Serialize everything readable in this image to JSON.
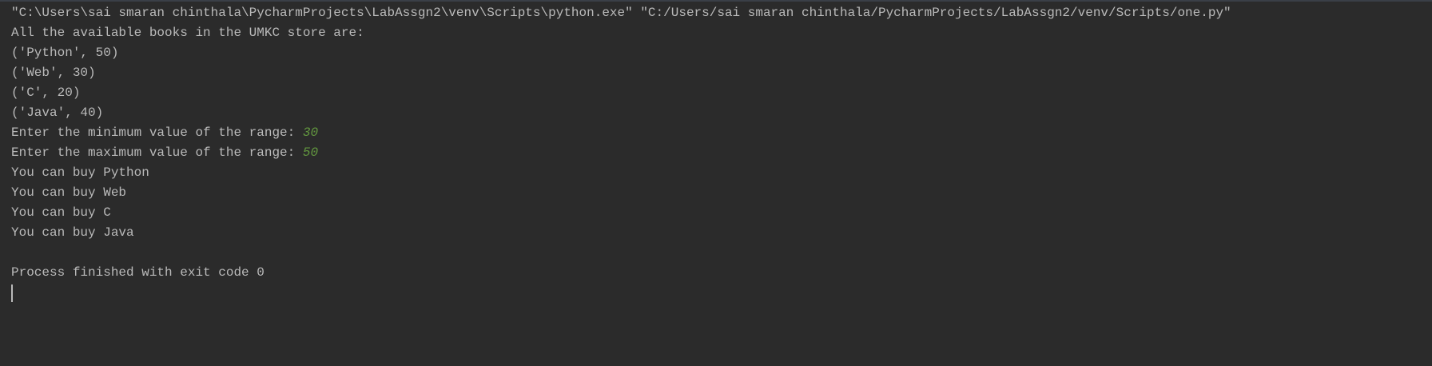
{
  "console": {
    "command": "\"C:\\Users\\sai smaran chinthala\\PycharmProjects\\LabAssgn2\\venv\\Scripts\\python.exe\" \"C:/Users/sai smaran chinthala/PycharmProjects/LabAssgn2/venv/Scripts/one.py\"",
    "header": "All the available books in the UMKC store are:",
    "books": [
      "('Python', 50)",
      "('Web', 30)",
      "('C', 20)",
      "('Java', 40)"
    ],
    "min_prompt": "Enter the minimum value of the range: ",
    "min_value": "30",
    "max_prompt": "Enter the maximum value of the range: ",
    "max_value": "50",
    "results": [
      "You can buy Python",
      "You can buy Web",
      "You can buy C",
      "You can buy Java"
    ],
    "exit_message": "Process finished with exit code 0"
  },
  "colors": {
    "background": "#2b2b2b",
    "text": "#bababa",
    "user_input": "#62973f"
  }
}
